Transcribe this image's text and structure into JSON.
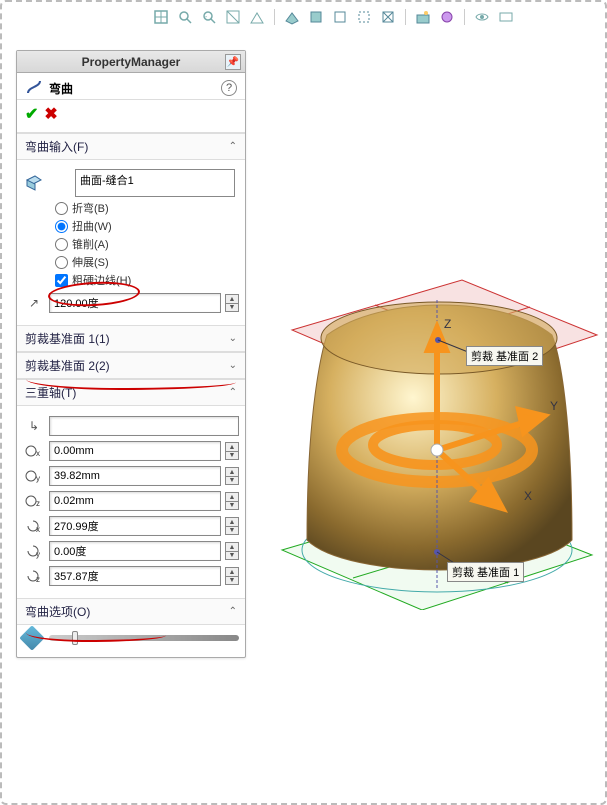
{
  "pm_title": "PropertyManager",
  "feature": {
    "title": "弯曲"
  },
  "sections": {
    "flex_input": {
      "title": "弯曲输入(F)",
      "body_item": "曲面-缝合1"
    },
    "options": {
      "bend": "折弯(B)",
      "twist": "扭曲(W)",
      "taper": "锥削(A)",
      "stretch": "伸展(S)",
      "hard_edges": "粗硬边线(H)",
      "angle": "120.00度"
    },
    "trim1": {
      "title": "剪裁基准面 1(1)"
    },
    "trim2": {
      "title": "剪裁基准面 2(2)"
    },
    "triad": {
      "title": "三重轴(T)",
      "x": "0.00mm",
      "y": "39.82mm",
      "z": "0.02mm",
      "rx": "270.99度",
      "ry": "0.00度",
      "rz": "357.87度"
    },
    "flex_options": {
      "title": "弯曲选项(O)"
    }
  },
  "viewport": {
    "label_trim2": "剪裁 基准面 2",
    "label_trim1": "剪裁 基准面 1",
    "axes": {
      "x": "X",
      "y": "Y",
      "z": "Z"
    }
  },
  "icons": {
    "angle": "↗",
    "origin": "↳",
    "cx": "Cx",
    "cy": "Cy",
    "cz": "Cz",
    "rx": "↻x",
    "ry": "↻y",
    "rz": "↻z"
  }
}
